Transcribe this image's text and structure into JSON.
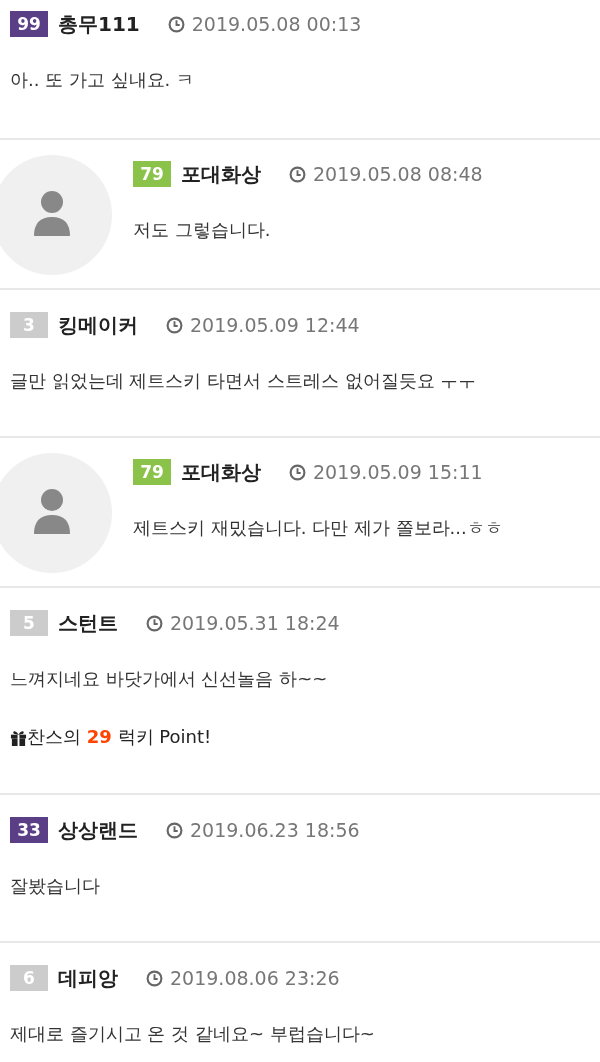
{
  "comments": [
    {
      "kind": "comment",
      "level": "99",
      "color": "#5b3f86",
      "author": "총무111",
      "date": "2019.05.08 00:13",
      "text": "아.. 또 가고 싶내요. ㅋ"
    },
    {
      "kind": "reply",
      "level": "79",
      "color": "#8bc34a",
      "author": "포대화상",
      "date": "2019.05.08 08:48",
      "text": "저도 그렇습니다."
    },
    {
      "kind": "comment",
      "level": "3",
      "color": "#cccccc",
      "author": "킹메이커",
      "date": "2019.05.09 12:44",
      "text": "글만 읽었는데 제트스키 타면서 스트레스 없어질듯요 ㅜㅜ"
    },
    {
      "kind": "reply",
      "level": "79",
      "color": "#8bc34a",
      "author": "포대화상",
      "date": "2019.05.09 15:11",
      "text": "제트스키 재밌습니다. 다만 제가 쫄보라...ㅎㅎ"
    },
    {
      "kind": "comment",
      "level": "5",
      "color": "#cccccc",
      "author": "스턴트",
      "date": "2019.05.31 18:24",
      "text": "느껴지네요 바닷가에서 신선놀음 하~~",
      "bonus": {
        "prefix": "찬스의 ",
        "points": "29",
        "suffix": " 럭키 Point!"
      }
    },
    {
      "kind": "comment",
      "level": "33",
      "color": "#5b3f86",
      "author": "상상랜드",
      "date": "2019.06.23 18:56",
      "text": "잘봤습니다"
    },
    {
      "kind": "comment",
      "level": "6",
      "color": "#cccccc",
      "author": "데피앙",
      "date": "2019.08.06 23:26",
      "text": "제대로 즐기시고 온 것 같네요~ 부럽습니다~"
    }
  ]
}
